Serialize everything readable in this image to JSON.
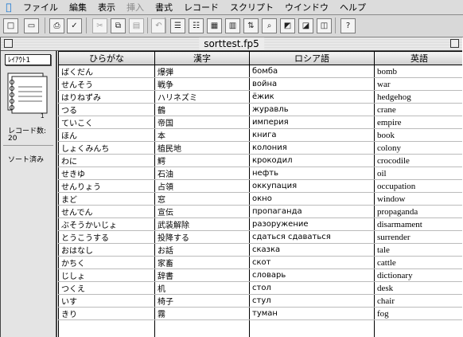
{
  "menubar": {
    "items": [
      {
        "label": "ファイル",
        "enabled": true
      },
      {
        "label": "編集",
        "enabled": true
      },
      {
        "label": "表示",
        "enabled": true
      },
      {
        "label": "挿入",
        "enabled": false
      },
      {
        "label": "書式",
        "enabled": true
      },
      {
        "label": "レコード",
        "enabled": true
      },
      {
        "label": "スクリプト",
        "enabled": true
      },
      {
        "label": "ウインドウ",
        "enabled": true
      },
      {
        "label": "ヘルプ",
        "enabled": true
      }
    ]
  },
  "toolbar": {
    "buttons": [
      {
        "name": "new-document-button",
        "icon": "new-document-icon",
        "glyph": "□",
        "enabled": true
      },
      {
        "name": "open-button",
        "icon": "folder-icon",
        "glyph": "▭",
        "enabled": true
      },
      {
        "name": "print-button",
        "icon": "printer-icon",
        "glyph": "⎙",
        "enabled": true
      },
      {
        "name": "spellcheck-button",
        "icon": "spellcheck-icon",
        "glyph": "✓",
        "enabled": true
      },
      {
        "name": "cut-button",
        "icon": "scissors-icon",
        "glyph": "✂",
        "enabled": false
      },
      {
        "name": "copy-button",
        "icon": "copy-icon",
        "glyph": "⧉",
        "enabled": true
      },
      {
        "name": "paste-button",
        "icon": "paste-icon",
        "glyph": "▤",
        "enabled": false
      },
      {
        "name": "undo-button",
        "icon": "undo-icon",
        "glyph": "↶",
        "enabled": false
      },
      {
        "name": "browse-mode-button",
        "icon": "browse-icon",
        "glyph": "☰",
        "enabled": true
      },
      {
        "name": "find-mode-button",
        "icon": "find-icon",
        "glyph": "☷",
        "enabled": true
      },
      {
        "name": "layout-mode-button",
        "icon": "layout-icon",
        "glyph": "▦",
        "enabled": true
      },
      {
        "name": "preview-mode-button",
        "icon": "preview-icon",
        "glyph": "▥",
        "enabled": true
      },
      {
        "name": "sort-button",
        "icon": "sort-icon",
        "glyph": "⇅",
        "enabled": true
      },
      {
        "name": "show-all-button",
        "icon": "show-all-icon",
        "glyph": "⌕",
        "enabled": true
      },
      {
        "name": "omit-button",
        "icon": "omit-icon",
        "glyph": "◩",
        "enabled": true
      },
      {
        "name": "replace-button",
        "icon": "replace-icon",
        "glyph": "◪",
        "enabled": true
      },
      {
        "name": "go-button",
        "icon": "go-icon",
        "glyph": "◫",
        "enabled": true
      },
      {
        "name": "help-button",
        "icon": "help-icon",
        "glyph": "?",
        "enabled": true
      }
    ]
  },
  "window": {
    "title": "sorttest.fp5"
  },
  "status_area": {
    "layout_popup": "ﾚｲｱｳﾄ1",
    "page_number": "1",
    "record_count_label": "レコード数:",
    "record_count": "20",
    "sort_status": "ソート済み"
  },
  "table": {
    "columns": [
      "ひらがな",
      "漢字",
      "ロシア語",
      "英語"
    ],
    "rows": [
      [
        "ばくだん",
        "爆弾",
        "бомба",
        "bomb"
      ],
      [
        "せんそう",
        "戦争",
        "война",
        "war"
      ],
      [
        "はりねずみ",
        "ハリネズミ",
        "ёжик",
        "hedgehog"
      ],
      [
        "つる",
        "鶴",
        "журавль",
        "crane"
      ],
      [
        "ていこく",
        "帝国",
        "империя",
        "empire"
      ],
      [
        "ほん",
        "本",
        "книга",
        "book"
      ],
      [
        "しょくみんち",
        "植民地",
        "колония",
        "colony"
      ],
      [
        "わに",
        "鰐",
        "крокодил",
        "crocodile"
      ],
      [
        "せきゆ",
        "石油",
        "нефть",
        "oil"
      ],
      [
        "せんりょう",
        "占領",
        "оккупация",
        "occupation"
      ],
      [
        "まど",
        "窓",
        "окно",
        "window"
      ],
      [
        "せんでん",
        "宣伝",
        "пропаганда",
        "propaganda"
      ],
      [
        "ぶそうかいじょ",
        "武装解除",
        "разоружение",
        "disarmament"
      ],
      [
        "とうこうする",
        "投降する",
        "сдаться сдаваться",
        "surrender"
      ],
      [
        "おはなし",
        "お話",
        "сказка",
        "tale"
      ],
      [
        "かちく",
        "家畜",
        "скот",
        "cattle"
      ],
      [
        "じしょ",
        "辞書",
        "словарь",
        "dictionary"
      ],
      [
        "つくえ",
        "机",
        "стол",
        "desk"
      ],
      [
        "いす",
        "椅子",
        "стул",
        "chair"
      ],
      [
        "きり",
        "霧",
        "туман",
        "fog"
      ]
    ]
  }
}
